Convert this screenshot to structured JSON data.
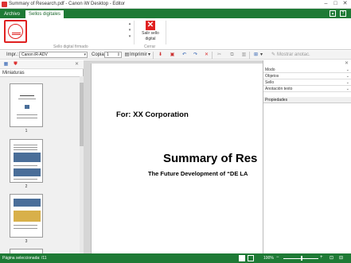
{
  "window": {
    "title": "Summary of Research.pdf - Canon iW Desktop - Editor"
  },
  "ribbon_tabs": [
    "Archivo",
    "Sellos digitales"
  ],
  "ribbon": {
    "stamp_group_label": "Sello digital firmado",
    "close_button_label_line1": "Salir sello",
    "close_button_label_line2": "digital",
    "close_group_label": "Cerrar"
  },
  "toolbar": {
    "printer_label": "Impr.:",
    "printer_value": "Canon iR-ADV",
    "copies_label": "Copias:",
    "copies_value": "1",
    "print_button": "Imprimir",
    "show_annotations": "Mostrar anotac."
  },
  "left_panel": {
    "title": "Miniaturas",
    "thumbnails": [
      "1",
      "2",
      "3"
    ]
  },
  "document": {
    "line1": "For: XX Corporation",
    "line2": "Summary of Res",
    "line3": "The Future Development of “DE LA"
  },
  "right_panel": {
    "sections": [
      "Modo",
      "Objetos",
      "Sello",
      "Anotación texto"
    ],
    "properties": "Propiedades"
  },
  "status": {
    "selected_pages": "Página seleccionada: /11",
    "zoom": "100%"
  },
  "colors": {
    "accent": "#1e7a35",
    "stamp": "#e02020"
  }
}
